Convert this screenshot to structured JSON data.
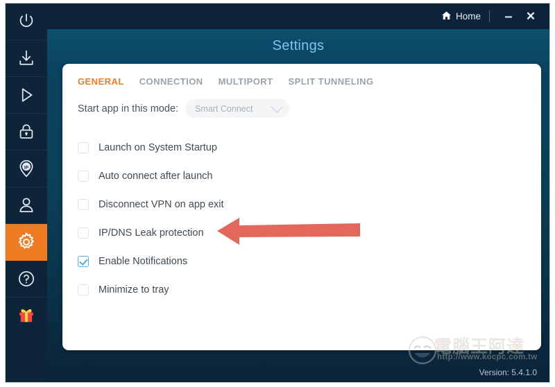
{
  "window": {
    "titlebar": {
      "home_label": "Home",
      "home_icon": "home-icon",
      "minimize_label": "–",
      "close_label": "✕"
    },
    "header_title": "Settings",
    "version_text": "Version: 5.4.1.0"
  },
  "sidebar": {
    "items": [
      {
        "name": "power",
        "icon": "power-icon",
        "active": false
      },
      {
        "name": "download",
        "icon": "download-icon",
        "active": false
      },
      {
        "name": "play",
        "icon": "play-icon",
        "active": false
      },
      {
        "name": "lock",
        "icon": "lock-icon",
        "active": false
      },
      {
        "name": "ip",
        "icon": "ip-pin-icon",
        "active": false
      },
      {
        "name": "account",
        "icon": "user-icon",
        "active": false
      },
      {
        "name": "settings",
        "icon": "gear-icon",
        "active": true
      },
      {
        "name": "help",
        "icon": "question-circle-icon",
        "active": false
      },
      {
        "name": "gift",
        "icon": "gift-icon",
        "active": false
      }
    ],
    "active_color": "#ef7c22"
  },
  "main": {
    "tabs": [
      {
        "label": "GENERAL",
        "active": true
      },
      {
        "label": "CONNECTION",
        "active": false
      },
      {
        "label": "MULTIPORT",
        "active": false
      },
      {
        "label": "SPLIT TUNNELING",
        "active": false
      }
    ],
    "mode": {
      "label": "Start app in this mode:",
      "value": "Smart Connect",
      "chevron_icon": "chevron-down-icon"
    },
    "options": [
      {
        "label": "Launch on System Startup",
        "checked": false
      },
      {
        "label": "Auto connect after launch",
        "checked": false
      },
      {
        "label": "Disconnect VPN on app exit",
        "checked": false
      },
      {
        "label": "IP/DNS Leak protection",
        "checked": false
      },
      {
        "label": "Enable Notifications",
        "checked": true
      },
      {
        "label": "Minimize to tray",
        "checked": false
      }
    ]
  },
  "annotation": {
    "arrow_color": "#e4675c",
    "arrow_points_to": "IP/DNS Leak protection"
  },
  "watermark": {
    "brand": "電腦王阿達",
    "url": "http://www.kocpc.com.tw"
  },
  "colors": {
    "accent_orange": "#ef7c22",
    "tab_active": "#f07c22",
    "checkbox_checked": "#4fb3e8",
    "header_title": "#7fc4ea",
    "sidebar_bg": "#0e2539",
    "titlebar_bg": "#0c2339"
  }
}
